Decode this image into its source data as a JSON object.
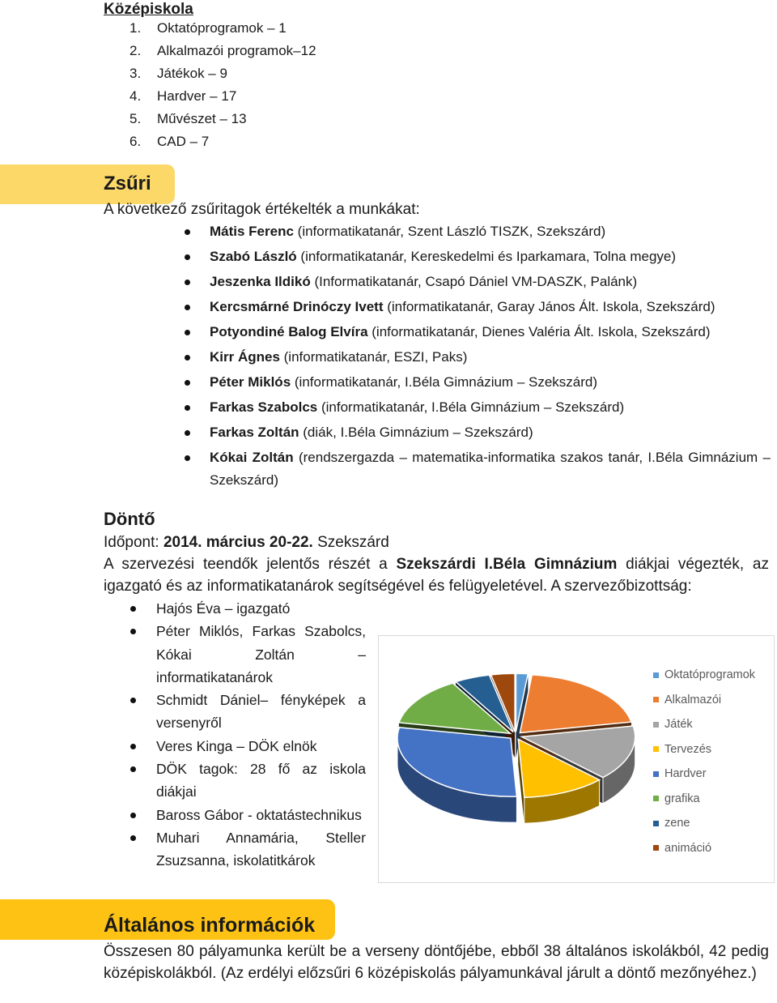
{
  "secondary": {
    "heading": "Középiskola",
    "items": [
      {
        "num": "1.",
        "text": "Oktatóprogramok – 1"
      },
      {
        "num": "2.",
        "text": "Alkalmazói programok–12"
      },
      {
        "num": "3.",
        "text": "Játékok – 9"
      },
      {
        "num": "4.",
        "text": "Hardver – 17"
      },
      {
        "num": "5.",
        "text": "Művészet – 13"
      },
      {
        "num": "6.",
        "text": "CAD – 7"
      }
    ]
  },
  "jury": {
    "title": "Zsűri",
    "intro": "A következő zsűritagok értékelték a munkákat:",
    "members": [
      {
        "name": "Mátis Ferenc",
        "detail": " (informatikatanár, Szent László TISZK, Szekszárd)"
      },
      {
        "name": "Szabó László",
        "detail": " (informatikatanár, Kereskedelmi és Iparkamara, Tolna megye)"
      },
      {
        "name": "Jeszenka Ildikó",
        "detail": " (Informatikatanár, Csapó Dániel VM-DASZK, Palánk)"
      },
      {
        "name": "Kercsmárné Drinóczy Ivett",
        "detail": " (informatikatanár, Garay János Ált. Iskola, Szekszárd)"
      },
      {
        "name": "Potyondiné Balog Elvíra",
        "detail": " (informatikatanár, Dienes Valéria Ált. Iskola, Szekszárd)"
      },
      {
        "name": "Kirr Ágnes",
        "detail": " (informatikatanár, ESZI, Paks)"
      },
      {
        "name": "Péter Miklós",
        "detail": " (informatikatanár, I.Béla Gimnázium – Szekszárd)"
      },
      {
        "name": "Farkas Szabolcs",
        "detail": " (informatikatanár, I.Béla Gimnázium – Szekszárd)"
      },
      {
        "name": "Farkas Zoltán",
        "detail": " (diák, I.Béla Gimnázium – Szekszárd)"
      },
      {
        "name": "Kókai Zoltán",
        "detail": " (rendszergazda – matematika-informatika szakos tanár, I.Béla Gimnázium – Szekszárd)"
      }
    ]
  },
  "final": {
    "title": "Döntő",
    "date_label": "Időpont: ",
    "date_value": "2014. március 20-22.",
    "date_place": " Szekszárd",
    "org_text_1": "A szervezési teendők jelentős részét a ",
    "org_school": "Szekszárdi I.Béla Gimnázium",
    "org_text_2": " diákjai végezték, az igazgató és az informatikatanárok segítségével és felügyeletével. A szervezőbizottság:",
    "committee": [
      "Hajós Éva – igazgató",
      "Péter Miklós, Farkas Szabolcs, Kókai Zoltán – informatikatanárok",
      "Schmidt Dániel– fényképek a versenyről",
      "Veres Kinga  – DÖK elnök",
      "DÖK tagok: 28 fő az iskola diákjai",
      "Baross Gábor - oktatástechnikus",
      "Muhari Annamária, Steller Zsuzsanna, iskolatitkárok"
    ]
  },
  "general": {
    "title": "Általános információk",
    "text": "Összesen 80 pályamunka került be a verseny döntőjébe, ebből 38 általános iskolákból, 42 pedig középiskolákból. (Az erdélyi előzsűri 6 középiskolás pályamunkával járult a döntő mezőnyéhez.)"
  },
  "colors": {
    "banner_light": "#fcd868",
    "banner_dark": "#fec214"
  },
  "chart_data": {
    "type": "pie",
    "style": "3d-exploded",
    "title": "",
    "legend_position": "right",
    "categories": [
      "Oktatóprogramok",
      "Alkalmazói",
      "Játék",
      "Tervezés",
      "Hardver",
      "grafika",
      "zene",
      "animáció"
    ],
    "values": [
      1,
      12,
      9,
      7,
      17,
      8,
      3,
      2
    ],
    "colors": [
      "#5b9bd5",
      "#ed7d31",
      "#a5a5a5",
      "#ffc000",
      "#4472c4",
      "#70ad47",
      "#255e91",
      "#9e480e"
    ]
  }
}
